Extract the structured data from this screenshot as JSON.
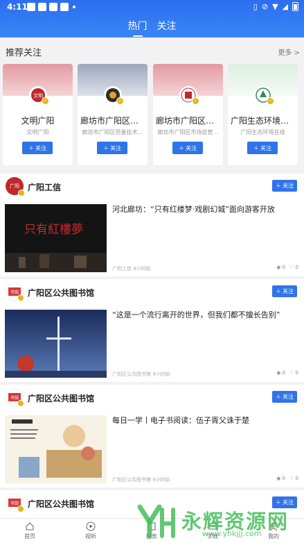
{
  "status": {
    "time": "4:11"
  },
  "tabs": [
    {
      "label": "热门"
    },
    {
      "label": "关注"
    }
  ],
  "recommend": {
    "title": "推荐关注",
    "more": "更多 >",
    "cards": [
      {
        "name": "文明广阳",
        "desc": "文明广阳",
        "follow": "关注",
        "banner": "#e7a7ad",
        "avatar_color": "#c0282c"
      },
      {
        "name": "廊坊市广阳区质…",
        "desc": "廊坊市广阳区质量技术…",
        "follow": "关注",
        "banner": "#aab2c4",
        "avatar_color": "#3a3a3a"
      },
      {
        "name": "廊坊市广阳区市…",
        "desc": "廊坊市广阳区市场监管…",
        "follow": "关注",
        "banner": "#e7a7ad",
        "avatar_color": "#c0282c"
      },
      {
        "name": "广阳生态环境在线",
        "desc": "广阳生态环境在线",
        "follow": "关注",
        "banner": "#e7f2ea",
        "avatar_color": "#2e8b57"
      }
    ]
  },
  "posts": [
    {
      "author": "广阳工信",
      "follow": "关注",
      "title": "河北廊坊：“只有红楼梦·戏剧幻城”面向游客开放",
      "meta": "广阳工信  4小时前",
      "views": "0",
      "likes": "0",
      "avatar_color": "#c0282c"
    },
    {
      "author": "广阳区公共图书馆",
      "follow": "关注",
      "title": "“这是一个流行离开的世界，但我们都不擅长告别”",
      "meta": "广阳区公共图书馆  9小时前",
      "views": "0",
      "likes": "0",
      "avatar_color": "#d43a3a"
    },
    {
      "author": "广阳区公共图书馆",
      "follow": "关注",
      "title": "每日一学丨电子书阅读：伍子胥父诛于楚",
      "meta": "广阳区公共图书馆  9小时前",
      "views": "0",
      "likes": "0",
      "avatar_color": "#d43a3a"
    },
    {
      "author": "广阳区公共图书馆",
      "follow": "关注",
      "avatar_color": "#d43a3a"
    }
  ],
  "bottom_nav": [
    {
      "label": "首页",
      "icon": "home-icon"
    },
    {
      "label": "视听",
      "icon": "play-icon"
    },
    {
      "label": "服务",
      "icon": "service-icon"
    },
    {
      "label": "学政",
      "icon": "study-icon"
    },
    {
      "label": "我的",
      "icon": "user-icon"
    }
  ],
  "watermark": {
    "text": "永辉资源网",
    "url": "www.yhkjjj.com"
  },
  "colors": {
    "primary": "#2f74e8",
    "header": "#2b6ef0"
  }
}
